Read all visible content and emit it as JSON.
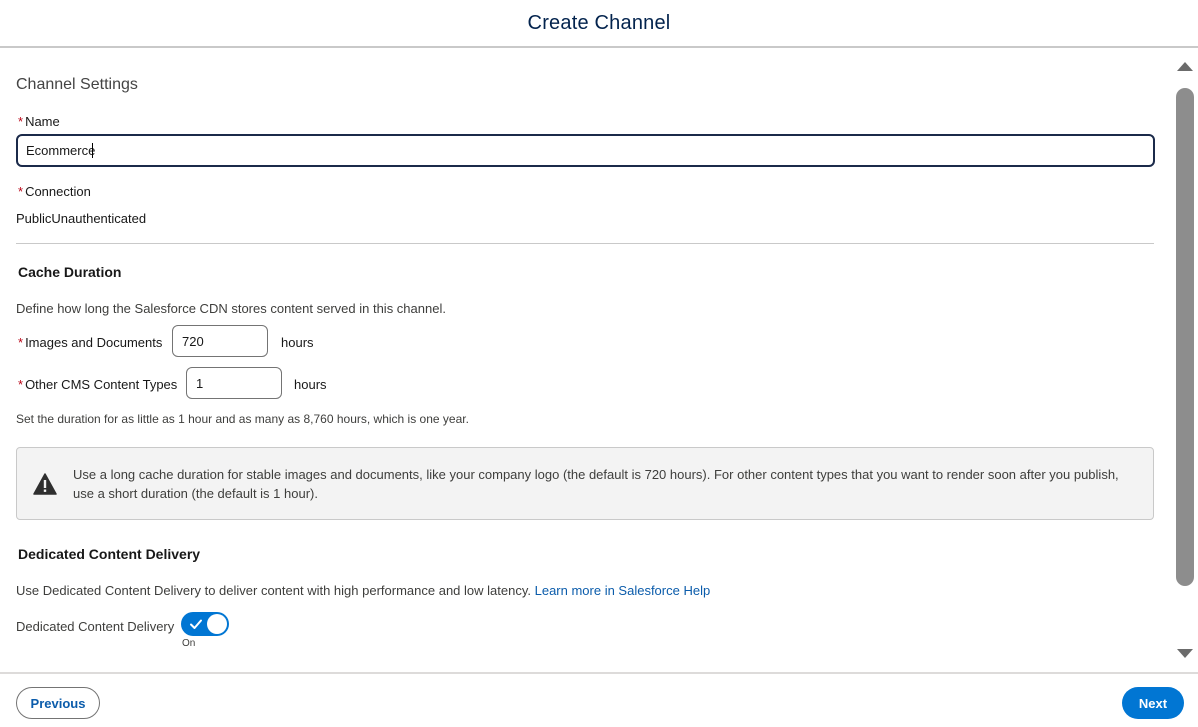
{
  "header": {
    "title": "Create Channel"
  },
  "channel_settings": {
    "section_title": "Channel Settings",
    "name": {
      "required_marker": "*",
      "label": "Name",
      "value": "Ecommerce"
    },
    "connection": {
      "required_marker": "*",
      "label": "Connection",
      "value": "PublicUnauthenticated"
    }
  },
  "cache_duration": {
    "heading": "Cache Duration",
    "description": "Define how long the Salesforce CDN stores content served in this channel.",
    "images_documents": {
      "required_marker": "*",
      "label": "Images and Documents",
      "value": "720",
      "unit": "hours"
    },
    "other_cms": {
      "required_marker": "*",
      "label": "Other CMS Content Types",
      "value": "1",
      "unit": "hours"
    },
    "help_text": "Set the duration for as little as 1 hour and as many as 8,760 hours, which is one year.",
    "alert": {
      "icon": "warning-icon",
      "text": "Use a long cache duration for stable images and documents, like your company logo (the default is 720 hours). For other content types that you want to render soon after you publish, use a short duration (the default is 1 hour)."
    }
  },
  "dedicated_delivery": {
    "heading": "Dedicated Content Delivery",
    "description": "Use Dedicated Content Delivery to deliver content with high performance and low latency.",
    "learn_more_link": "Learn more in Salesforce Help",
    "toggle_label": "Dedicated Content Delivery",
    "toggle_state": "On",
    "toggle_on": true
  },
  "footer": {
    "previous_label": "Previous",
    "next_label": "Next"
  },
  "colors": {
    "brand_blue": "#0176d3",
    "link_blue": "#0b5cab",
    "title_navy": "#03234d",
    "required_red": "#ba0517"
  }
}
